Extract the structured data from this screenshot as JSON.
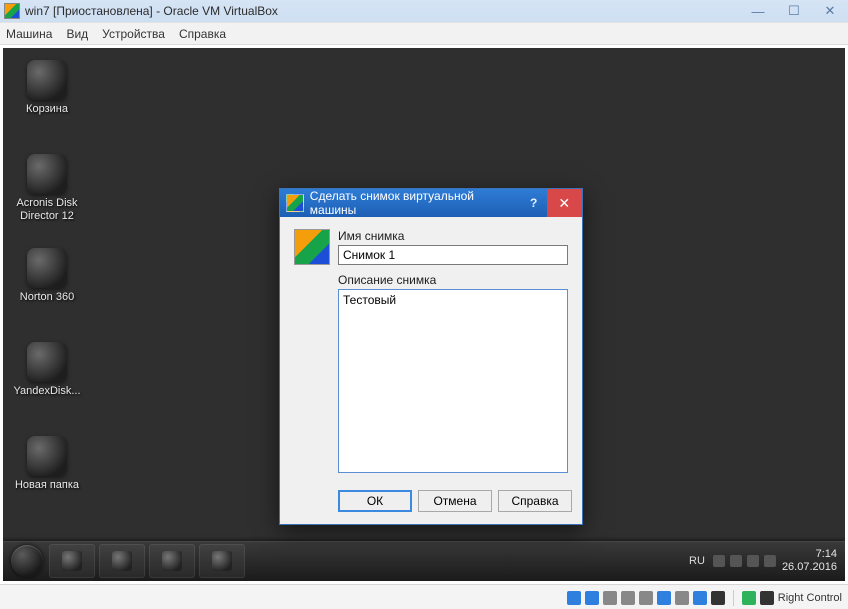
{
  "host": {
    "title": "win7 [Приостановлена] - Oracle VM VirtualBox",
    "menu": {
      "machine": "Машина",
      "view": "Вид",
      "devices": "Устройства",
      "help": "Справка"
    },
    "status": {
      "host_key": "Right Control"
    }
  },
  "guest": {
    "desktop_icons": [
      {
        "label": "Корзина"
      },
      {
        "label": "Acronis Disk Director 12"
      },
      {
        "label": "Norton 360"
      },
      {
        "label": "YandexDisk..."
      },
      {
        "label": "Новая папка"
      }
    ],
    "taskbar": {
      "lang": "RU",
      "time": "7:14",
      "date": "26.07.2016"
    }
  },
  "dialog": {
    "title": "Сделать снимок виртуальной машины",
    "name_label": "Имя снимка",
    "name_value": "Снимок 1",
    "desc_label": "Описание снимка",
    "desc_value": "Тестовый",
    "buttons": {
      "ok": "ОК",
      "cancel": "Отмена",
      "help": "Справка"
    }
  }
}
